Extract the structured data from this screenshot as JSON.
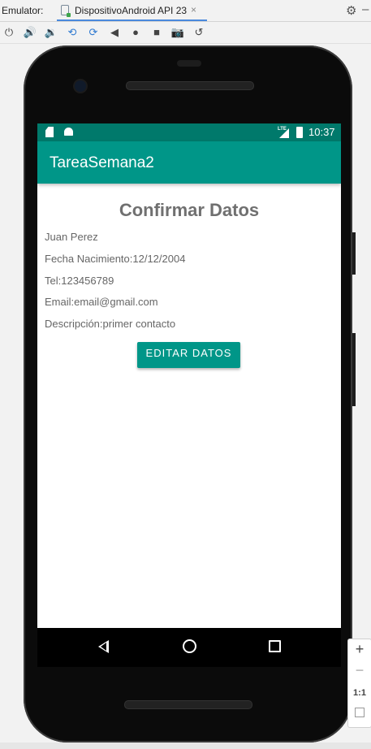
{
  "ide": {
    "emulator_label": "Emulator:",
    "tab_title": "DispositivoAndroid API 23",
    "tab_close": "×"
  },
  "toolbar": {
    "icons": [
      "power-icon",
      "volume-up-icon",
      "volume-down-icon",
      "rotate-left-icon",
      "rotate-right-icon",
      "back-icon",
      "home-icon",
      "overview-icon",
      "camera-icon",
      "snapshot-icon"
    ]
  },
  "status_bar": {
    "network": "LTE",
    "time": "10:37"
  },
  "app": {
    "title": "TareaSemana2",
    "accent_color": "#009688",
    "status_color": "#00796b"
  },
  "content": {
    "heading": "Confirmar Datos",
    "name": "Juan Perez",
    "birth": "Fecha Nacimiento:12/12/2004",
    "phone": "Tel:123456789",
    "email": "Email:email@gmail.com",
    "description": "Descripción:primer contacto",
    "edit_button": "EDITAR DATOS"
  },
  "zoom_controls": {
    "plus": "+",
    "minus": "−",
    "actual_size": "1:1"
  }
}
